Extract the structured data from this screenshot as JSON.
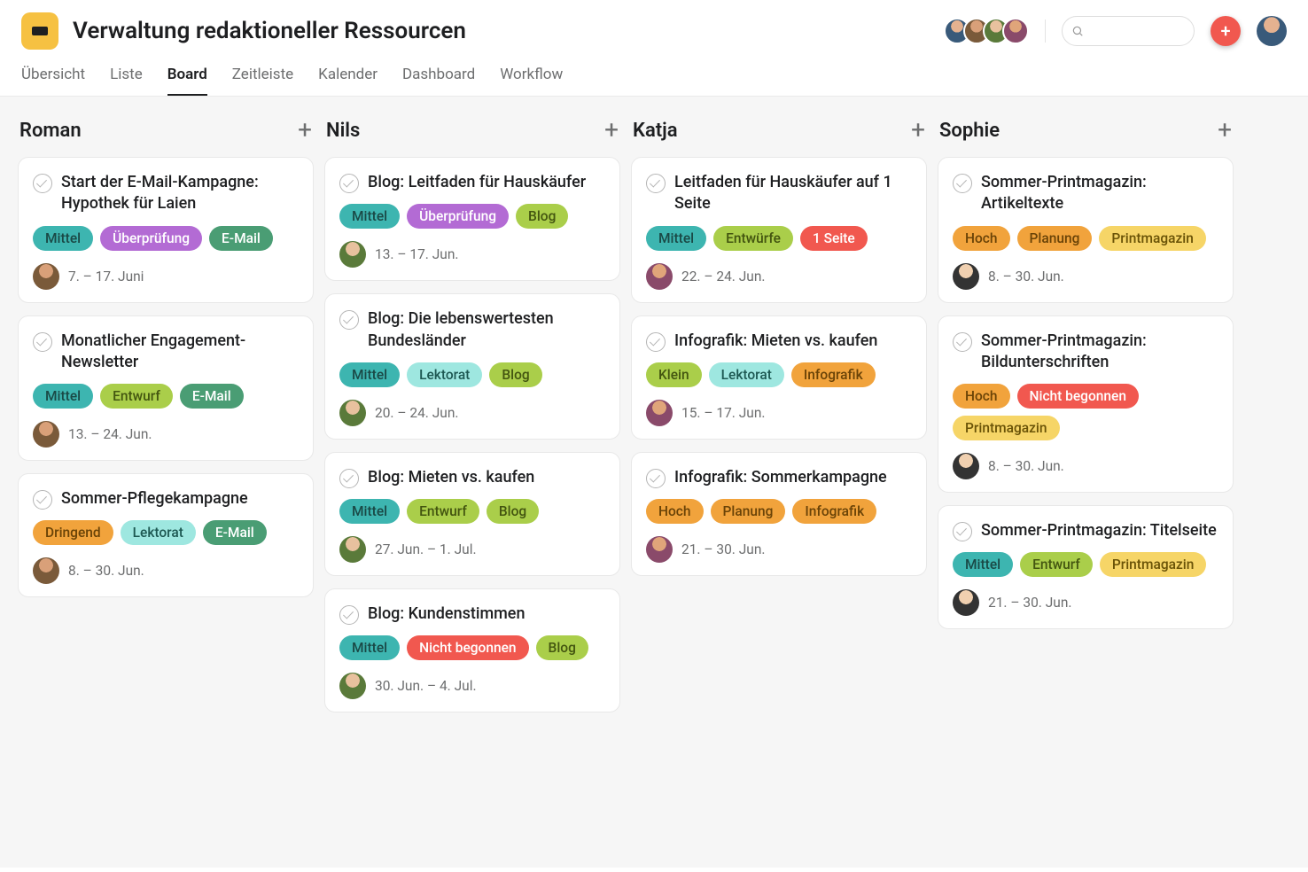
{
  "header": {
    "title": "Verwaltung redaktioneller Ressourcen"
  },
  "tabs": [
    {
      "label": "Übersicht",
      "active": false
    },
    {
      "label": "Liste",
      "active": false
    },
    {
      "label": "Board",
      "active": true
    },
    {
      "label": "Zeitleiste",
      "active": false
    },
    {
      "label": "Kalender",
      "active": false
    },
    {
      "label": "Dashboard",
      "active": false
    },
    {
      "label": "Workflow",
      "active": false
    }
  ],
  "search": {
    "placeholder": ""
  },
  "tag_palette": {
    "Mittel": "c-teal",
    "Überprüfung": "c-purple",
    "E-Mail": "c-green-d",
    "Entwurf": "c-lime",
    "Entwürfe": "c-lime",
    "Dringend": "c-orange",
    "Lektorat": "c-mint",
    "Blog": "c-lime",
    "Nicht begonnen": "c-red",
    "1 Seite": "c-red",
    "Klein": "c-lime",
    "Infografik": "c-orange",
    "Hoch": "c-orange",
    "Planung": "c-orange",
    "Printmagazin": "c-yellow"
  },
  "columns": [
    {
      "name": "Roman",
      "cards": [
        {
          "title": "Start der E-Mail-Kampagne: Hypothek für Laien",
          "tags": [
            "Mittel",
            "Überprüfung",
            "E-Mail"
          ],
          "date": "7. – 17. Juni",
          "avatar": "av-b"
        },
        {
          "title": "Monatlicher Engagement-Newsletter",
          "tags": [
            "Mittel",
            "Entwurf",
            "E-Mail"
          ],
          "date": "13. – 24. Jun.",
          "avatar": "av-b"
        },
        {
          "title": "Sommer-Pflegekampagne",
          "tags": [
            "Dringend",
            "Lektorat",
            "E-Mail"
          ],
          "date": "8. – 30. Jun.",
          "avatar": "av-b"
        }
      ]
    },
    {
      "name": "Nils",
      "cards": [
        {
          "title": "Blog: Leitfaden für Hauskäufer",
          "tags": [
            "Mittel",
            "Überprüfung",
            "Blog"
          ],
          "date": "13. – 17. Jun.",
          "avatar": "av-c"
        },
        {
          "title": "Blog: Die lebenswertesten Bundesländer",
          "tags": [
            "Mittel",
            "Lektorat",
            "Blog"
          ],
          "date": "20. – 24. Jun.",
          "avatar": "av-c"
        },
        {
          "title": "Blog: Mieten vs. kaufen",
          "tags": [
            "Mittel",
            "Entwurf",
            "Blog"
          ],
          "date": "27. Jun. – 1. Jul.",
          "avatar": "av-c"
        },
        {
          "title": "Blog: Kundenstimmen",
          "tags": [
            "Mittel",
            "Nicht begonnen",
            "Blog"
          ],
          "date": "30. Jun. – 4. Jul.",
          "avatar": "av-c"
        }
      ]
    },
    {
      "name": "Katja",
      "cards": [
        {
          "title": "Leitfaden für Hauskäufer auf 1 Seite",
          "tags": [
            "Mittel",
            "Entwürfe",
            "1 Seite"
          ],
          "date": "22. – 24. Jun.",
          "avatar": "av-d"
        },
        {
          "title": "Infografik: Mieten vs. kaufen",
          "tags": [
            "Klein",
            "Lektorat",
            "Infografik"
          ],
          "date": "15. – 17. Jun.",
          "avatar": "av-d"
        },
        {
          "title": "Infografik: Sommerkampagne",
          "tags": [
            "Hoch",
            "Planung",
            "Infografik"
          ],
          "date": "21. – 30. Jun.",
          "avatar": "av-d"
        }
      ]
    },
    {
      "name": "Sophie",
      "cards": [
        {
          "title": "Sommer-Printmagazin: Artikeltexte",
          "tags": [
            "Hoch",
            "Planung",
            "Printmagazin"
          ],
          "date": "8. – 30. Jun.",
          "avatar": "av-e"
        },
        {
          "title": "Sommer-Printmagazin: Bildunterschriften",
          "tags": [
            "Hoch",
            "Nicht begonnen",
            "Printmagazin"
          ],
          "date": "8. – 30. Jun.",
          "avatar": "av-e"
        },
        {
          "title": "Sommer-Printmagazin: Titelseite",
          "tags": [
            "Mittel",
            "Entwurf",
            "Printmagazin"
          ],
          "date": "21. – 30. Jun.",
          "avatar": "av-e"
        }
      ]
    }
  ]
}
